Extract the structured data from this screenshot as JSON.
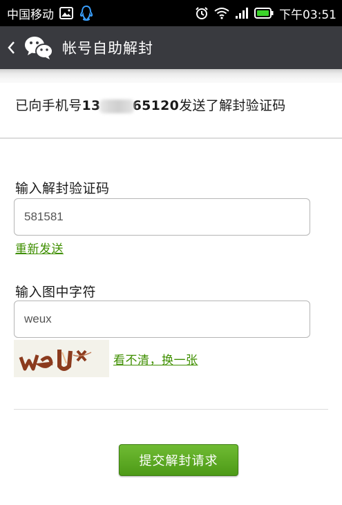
{
  "status_bar": {
    "carrier": "中国移动",
    "time": "下午03:51",
    "icons": [
      "image-icon",
      "qq-icon",
      "alarm-icon",
      "wifi-icon",
      "signal-icon",
      "battery-icon"
    ]
  },
  "header": {
    "title": "帐号自助解封"
  },
  "notice": {
    "prefix": "已向手机号",
    "phone_start": "13",
    "phone_end": "65120",
    "suffix": "发送了解封验证码"
  },
  "verify_code": {
    "label": "输入解封验证码",
    "value": "581581",
    "resend_link": "重新发送"
  },
  "captcha": {
    "label": "输入图中字符",
    "value": "weux",
    "refresh_link": "看不清，换一张"
  },
  "submit": {
    "label": "提交解封请求"
  },
  "colors": {
    "accent": "#3f8f00",
    "button": "#5aa820",
    "actionbar": "#393a3f"
  }
}
